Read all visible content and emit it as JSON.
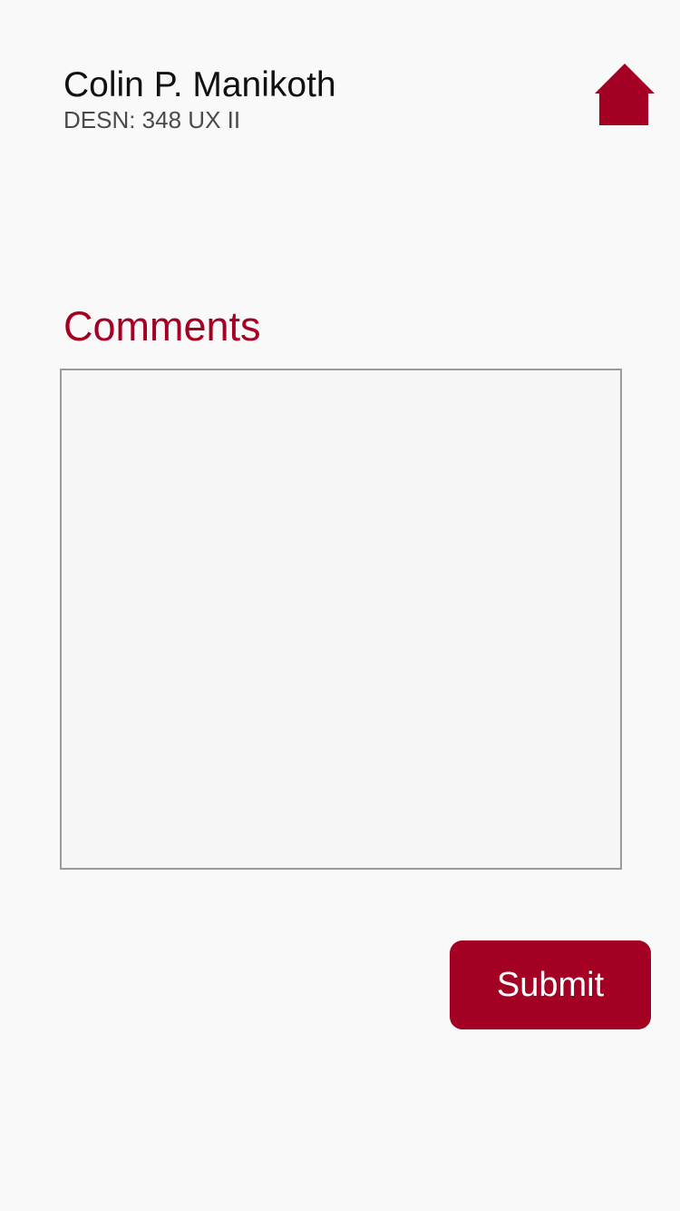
{
  "header": {
    "name": "Colin P. Manikoth",
    "course": "DESN: 348 UX II",
    "home_icon": "home-icon"
  },
  "form": {
    "comments_label": "Comments",
    "comments_value": "",
    "submit_label": "Submit"
  },
  "colors": {
    "accent": "#a30024",
    "background": "#f9f9f9",
    "field_background": "#f6f6f6",
    "field_border": "#9a9a9a"
  }
}
